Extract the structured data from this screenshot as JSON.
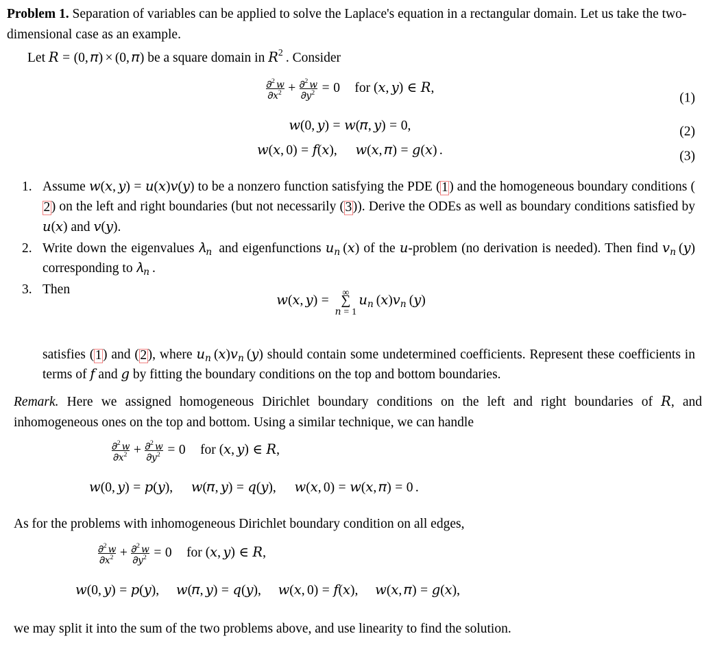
{
  "document": {
    "problem_label": "Problem 1.",
    "intro_text": " Separation of variables can be applied to solve the Laplace's equation in a rectangular domain. Let us take the two-dimensional case as an example.",
    "domain_line_prefix": "Let ",
    "domain_line_math": "R = (0, π) × (0, π)",
    "domain_line_middle": " be a square domain in ",
    "domain_line_math2": "ℝ²",
    "domain_line_suffix": ". Consider"
  },
  "equations_main": [
    {
      "number": "(1)",
      "latex": "∂²w/∂x² + ∂²w/∂y² = 0   for (x, y) ∈ R,",
      "for_text": "for"
    },
    {
      "number": "(2)",
      "latex": "w(0, y) = w(π, y) = 0,"
    },
    {
      "number": "(3)",
      "latex": "w(x, 0) = f(x),   w(x, π) = g(x)."
    }
  ],
  "list_items": [
    {
      "marker": "1.",
      "seg1": "Assume ",
      "math1": "w(x, y) = u(x)v(y)",
      "seg2": " to be a nonzero function satisfying the PDE (",
      "ref1": "1",
      "seg3": ") and the homogeneous boundary conditions (",
      "ref2": "2",
      "seg4": ") on the left and right boundaries (but not necessarily (",
      "ref3": "3",
      "seg5": ")). Derive the ODEs as well as boundary conditions satisfied by ",
      "math2": "u(x)",
      "seg6": " and ",
      "math3": "v(y)",
      "seg7": "."
    },
    {
      "marker": "2.",
      "seg1": "Write down the eigenvalues ",
      "math1": "λₙ",
      "seg2": " and eigenfunctions ",
      "math2": "uₙ(x)",
      "seg3": " of the ",
      "math3": "u",
      "seg4": "-problem (no derivation is needed). Then find ",
      "math4": "vₙ(y)",
      "seg5": " corresponding to ",
      "math5": "λₙ",
      "seg6": "."
    },
    {
      "marker": "3.",
      "seg1": "Then"
    }
  ],
  "sum_equation": {
    "latex": "w(x, y) = Σ_{n=1}^{∞} uₙ(x)vₙ(y)",
    "upper_limit": "∞",
    "lower_limit": "n=1"
  },
  "satisfies_paragraph": {
    "seg1": "satisfies (",
    "ref1": "1",
    "seg2": ") and (",
    "ref2": "2",
    "seg3": "), where ",
    "math1": "uₙ(x)vₙ(y)",
    "seg4": " should contain some undetermined coefficients. Represent these coefficients in terms of ",
    "math2": "f",
    "seg5": " and ",
    "math3": "g",
    "seg6": " by fitting the boundary conditions on the top and bottom boundaries."
  },
  "remark_paragraph": {
    "label": "Remark.",
    "seg1": " Here we assigned homogeneous Dirichlet boundary conditions on the left and right boundaries of ",
    "math1": "R",
    "seg2": ", and inhomogeneous ones on the top and bottom. Using a similar technique, we can handle"
  },
  "equations_remark": [
    {
      "latex": "∂²w/∂x² + ∂²w/∂y² = 0   for (x, y) ∈ R,"
    },
    {
      "latex": "w(0, y) = p(y),   w(π, y) = q(y),   w(x, 0) = w(x, π) = 0."
    }
  ],
  "asfor_paragraph": {
    "text": "As for the problems with inhomogeneous Dirichlet boundary condition on all edges,"
  },
  "equations_final": [
    {
      "latex": "∂²w/∂x² + ∂²w/∂y² = 0   for (x, y) ∈ R,"
    },
    {
      "latex": "w(0, y) = p(y),   w(π, y) = q(y),   w(x, 0) = f(x),   w(x, π) = g(x),"
    }
  ],
  "closing_paragraph": {
    "text": "we may split it into the sum of the two problems above, and use linearity to find the solution."
  },
  "colors": {
    "text": "#000000",
    "link_box_border": "#f08080",
    "background": "#ffffff"
  },
  "labels": {
    "for": "for"
  }
}
